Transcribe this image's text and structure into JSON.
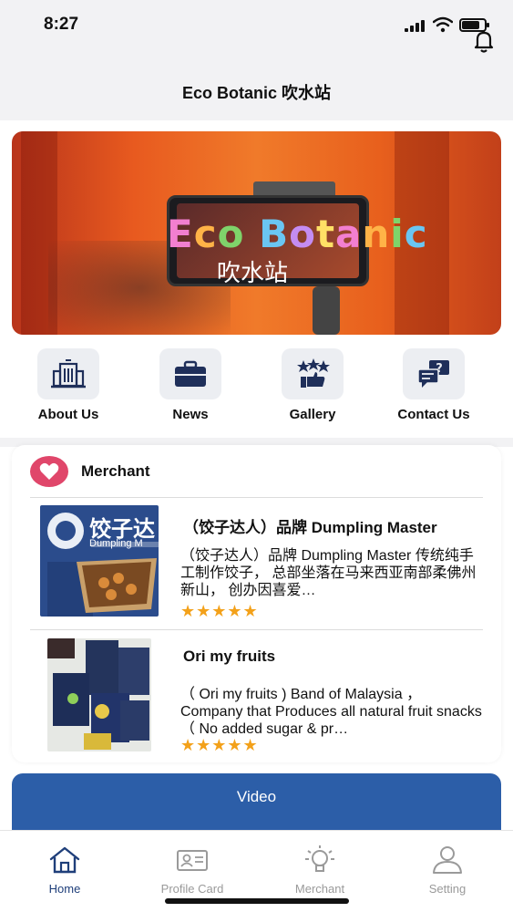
{
  "status": {
    "time": "8:27",
    "battery_level": 0.8,
    "signal_bars": 4
  },
  "header": {
    "title": "Eco Botanic 吹水站",
    "bell_icon": "bell-icon"
  },
  "banner": {
    "title_letters": [
      "E",
      "c",
      "o",
      " ",
      "B",
      "o",
      "t",
      "a",
      "n",
      "i",
      "c"
    ],
    "subtitle": "吹水站"
  },
  "quick_nav": [
    {
      "label": "About Us",
      "icon": "building-icon"
    },
    {
      "label": "News",
      "icon": "briefcase-icon"
    },
    {
      "label": "Gallery",
      "icon": "stars-thumb-icon"
    },
    {
      "label": "Contact Us",
      "icon": "chat-question-icon"
    }
  ],
  "merchant": {
    "title": "Merchant",
    "icon": "heart-icon",
    "items": [
      {
        "name": "（饺子达人）品牌 Dumpling Master",
        "description": "（饺子达人）品牌 Dumpling Master 传统纯手工制作饺子， 总部坐落在马来西亚南部柔佛州新山， 创办因喜爱…",
        "rating": 5,
        "stars": "★★★★★",
        "thumb_text": "饺子达",
        "thumb_sub": "Dumpling M"
      },
      {
        "name": "Ori my fruits",
        "description": "（ Ori my fruits ) Band of Malaysia ， Company that Produces all natural fruit snacks （ No added  sugar & pr…",
        "rating": 5,
        "stars": "★★★★★"
      }
    ]
  },
  "video": {
    "label": "Video"
  },
  "tabs": [
    {
      "label": "Home",
      "icon": "home-icon",
      "active": true
    },
    {
      "label": "Profile Card",
      "icon": "id-card-icon",
      "active": false
    },
    {
      "label": "Merchant",
      "icon": "lightbulb-icon",
      "active": false
    },
    {
      "label": "Setting",
      "icon": "user-icon",
      "active": false
    }
  ],
  "colors": {
    "accent": "#2c5ea8",
    "star": "#f3a11a",
    "heart": "#e0466a",
    "tab_active": "#1f3f7a"
  }
}
